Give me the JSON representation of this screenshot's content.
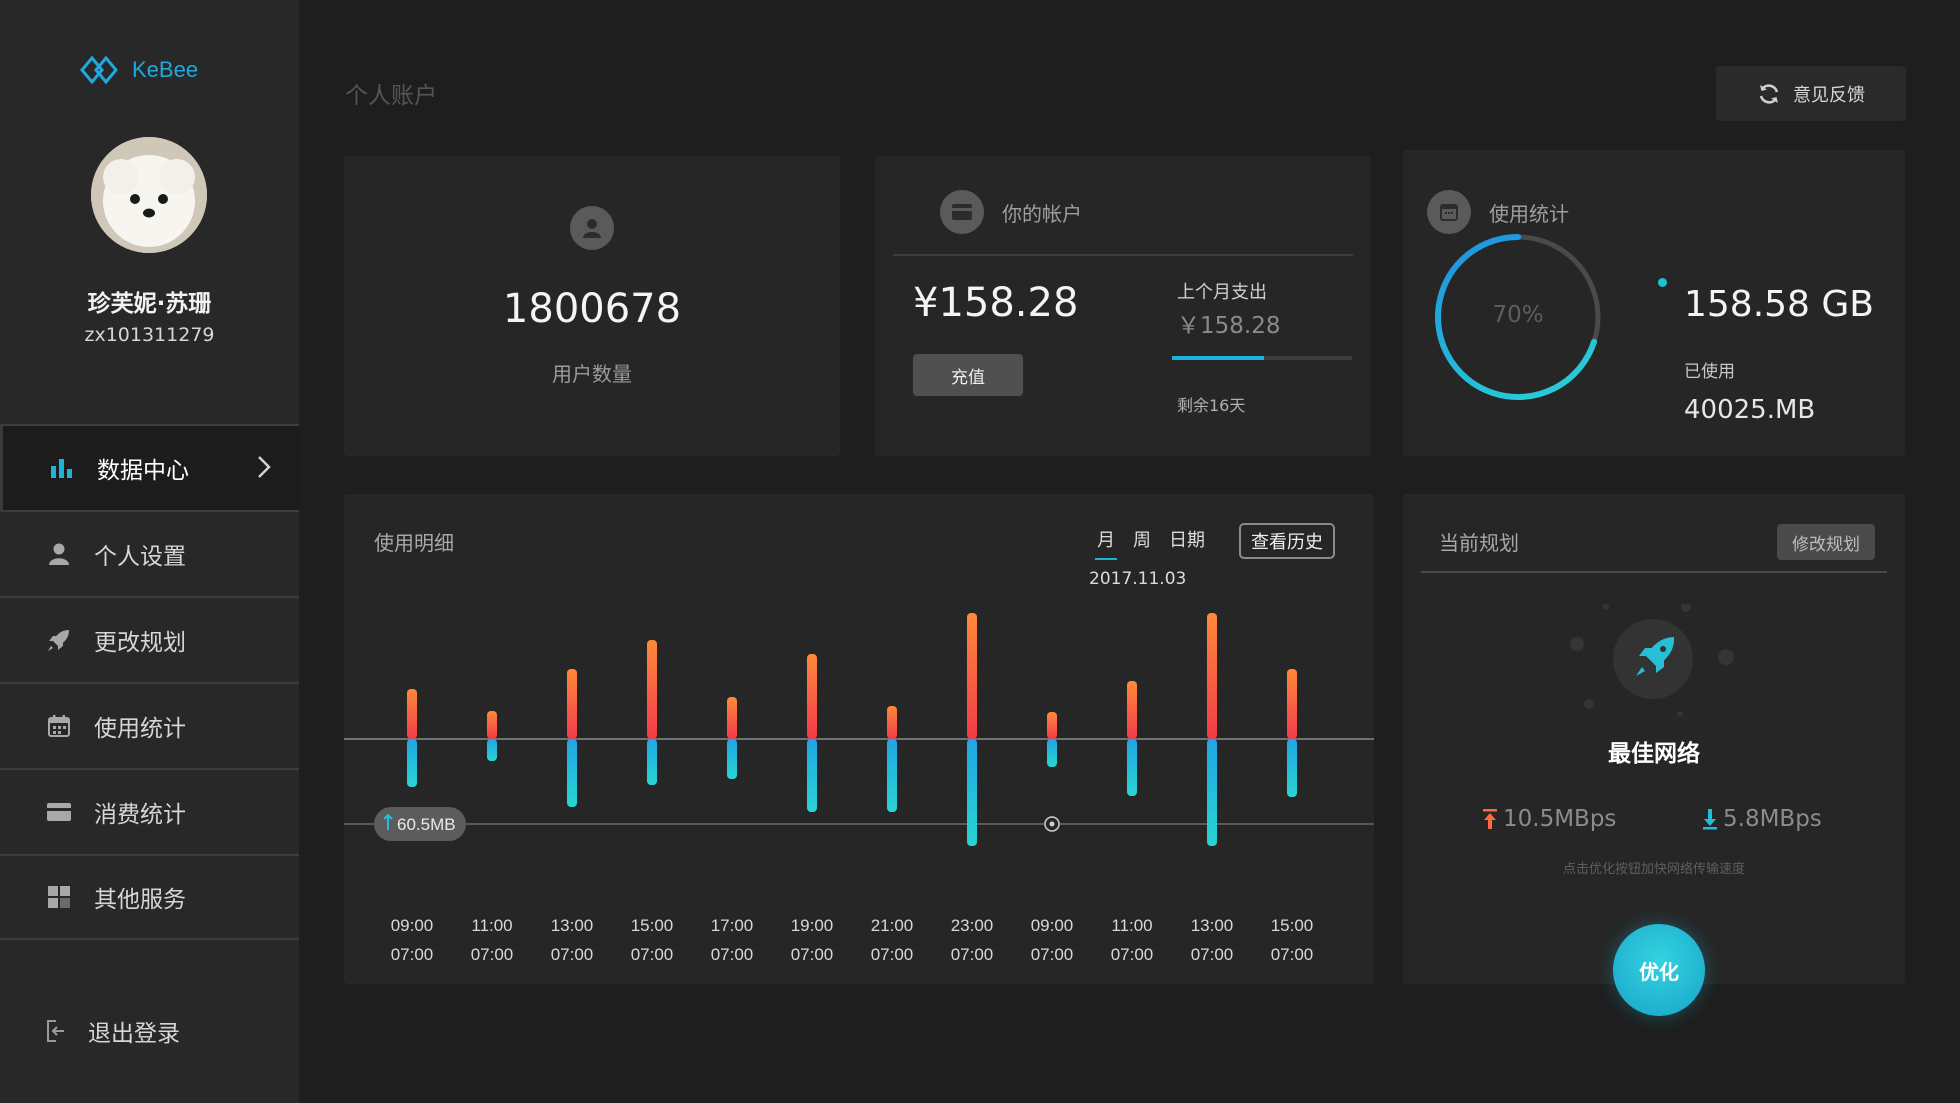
{
  "app": {
    "logo_text": "KeBee",
    "brand_color": "#1fa9dd",
    "accent": "#1cb3d8"
  },
  "user": {
    "name": "珍芙妮·苏珊",
    "id": "zx101311279"
  },
  "sidebar": {
    "items": [
      {
        "label": "数据中心",
        "icon": "bar-chart-icon",
        "active": true
      },
      {
        "label": "个人设置",
        "icon": "person-icon"
      },
      {
        "label": "更改规划",
        "icon": "rocket-icon"
      },
      {
        "label": "使用统计",
        "icon": "calendar-icon"
      },
      {
        "label": "消费统计",
        "icon": "card-icon"
      },
      {
        "label": "其他服务",
        "icon": "grid-icon"
      }
    ],
    "logout": "退出登录"
  },
  "header": {
    "title": "个人账户",
    "feedback": "意见反馈"
  },
  "users": {
    "value": "1800678",
    "label": "用户数量"
  },
  "account": {
    "title": "你的帐户",
    "balance": "¥158.28",
    "recharge": "充值",
    "last_month_label": "上个月支出",
    "last_month_value": "￥158.28",
    "remaining_fraction": 0.51,
    "remaining": "剩余16天"
  },
  "stats": {
    "title": "使用统计",
    "percent": "70%",
    "percent_value": 0.7,
    "total": "158.58 GB",
    "used_label": "已使用",
    "used": "40025.MB"
  },
  "detail": {
    "title": "使用明细",
    "tabs": [
      "月",
      "周",
      "日期"
    ],
    "active_tab": 0,
    "history": "查看历史",
    "date": "2017.11.03",
    "tooltip": "60.5MB",
    "time_top": [
      "09:00",
      "11:00",
      "13:00",
      "15:00",
      "17:00",
      "19:00",
      "21:00",
      "23:00",
      "09:00",
      "11:00",
      "13:00",
      "15:00"
    ],
    "time_bottom": [
      "07:00",
      "07:00",
      "07:00",
      "07:00",
      "07:00",
      "07:00",
      "07:00",
      "07:00",
      "07:00",
      "07:00",
      "07:00",
      "07:00"
    ],
    "upload": [
      50,
      28,
      70,
      99,
      42,
      85,
      33,
      126,
      27,
      58,
      126,
      70
    ],
    "download": [
      48,
      22,
      68,
      46,
      40,
      73,
      73,
      107,
      28,
      57,
      107,
      58
    ]
  },
  "plan": {
    "title": "当前规划",
    "edit": "修改规划",
    "network": "最佳网络",
    "upload_speed": "10.5MBps",
    "download_speed": "5.8MBps",
    "hint": "点击优化按钮加快网络传输速度",
    "optimize": "优化"
  }
}
